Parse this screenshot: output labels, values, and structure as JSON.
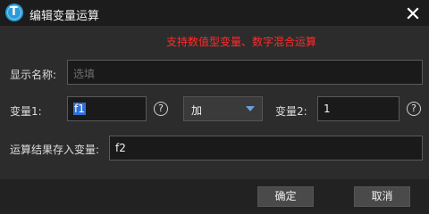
{
  "window": {
    "title": "编辑变量运算",
    "icon": "app-logo-icon",
    "icon_letter": "T",
    "close_icon": "close-icon"
  },
  "hint": "支持数值型变量、数字混合运算",
  "display_name": {
    "label": "显示名称:",
    "value": "",
    "placeholder": "选填"
  },
  "var1": {
    "label": "变量1:",
    "value": "f1",
    "help_icon": "help-icon",
    "help_glyph": "?"
  },
  "operator": {
    "selected": "加",
    "arrow_icon": "dropdown-arrow-icon"
  },
  "var2": {
    "label": "变量2:",
    "value": "1",
    "help_icon": "help-icon",
    "help_glyph": "?"
  },
  "result": {
    "label": "运算结果存入变量:",
    "value": "f2"
  },
  "buttons": {
    "ok": "确定",
    "cancel": "取消"
  },
  "colors": {
    "accent": "#2b9bd8",
    "hint": "#ff2b2b",
    "background": "#2c2c2c",
    "titlebar": "#1c1c1c"
  }
}
